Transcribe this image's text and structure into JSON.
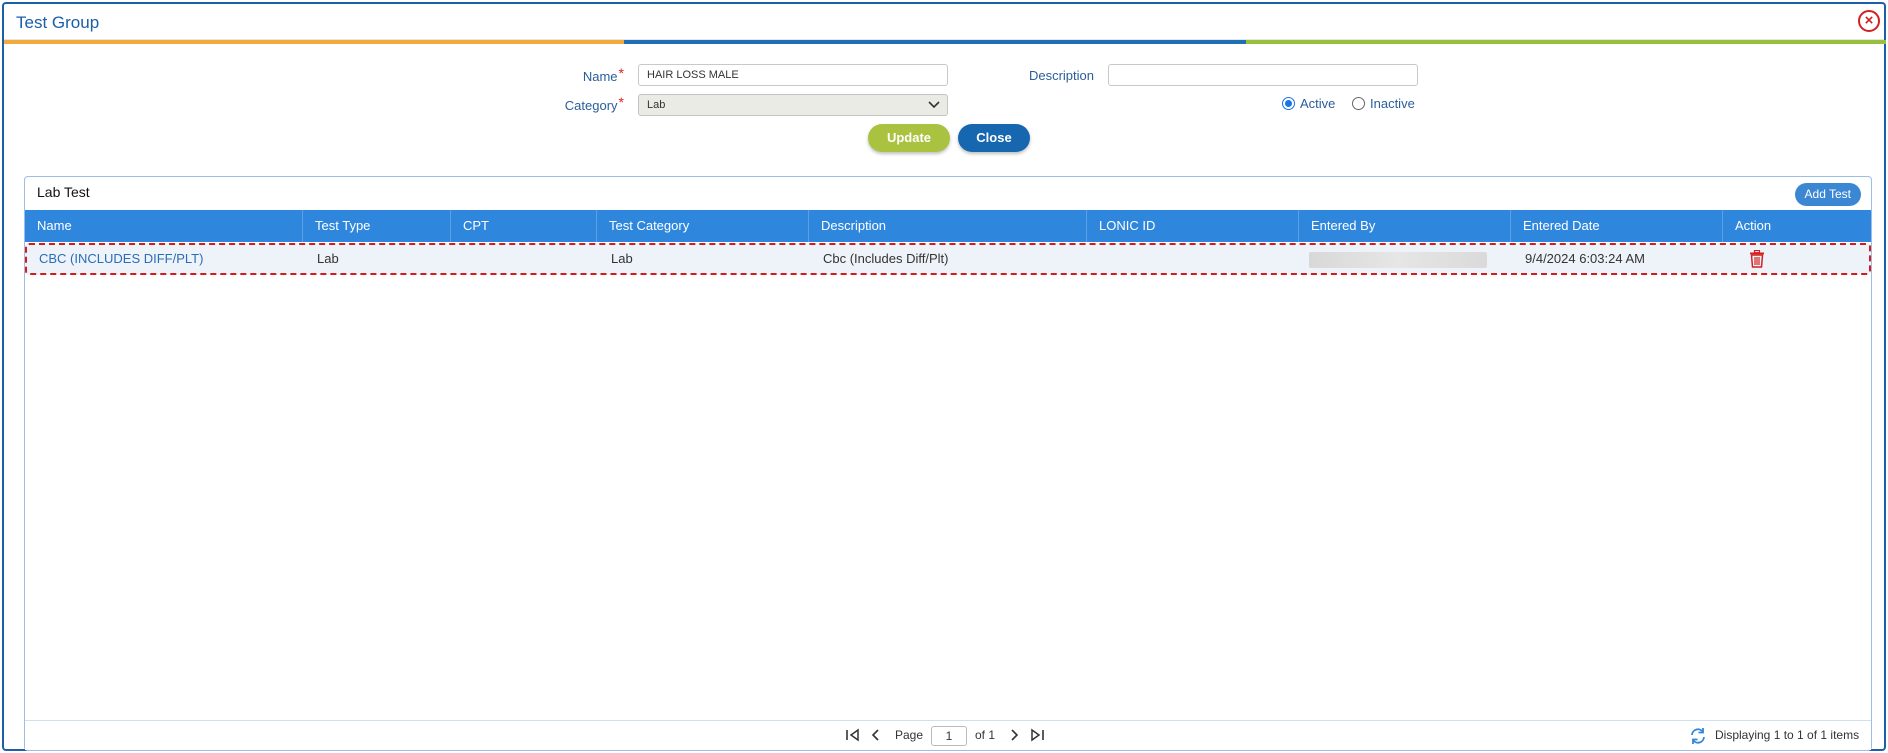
{
  "dialog": {
    "title": "Test Group"
  },
  "form": {
    "name_label": "Name",
    "name_value": "HAIR LOSS  MALE",
    "category_label": "Category",
    "category_value": "Lab",
    "description_label": "Description",
    "description_value": "",
    "required_marker": "*",
    "status_options": [
      {
        "label": "Active",
        "selected": true
      },
      {
        "label": "Inactive",
        "selected": false
      }
    ],
    "update_label": "Update",
    "close_label": "Close"
  },
  "lab_test": {
    "title": "Lab Test",
    "add_test_label": "Add Test",
    "columns": [
      "Name",
      "Test Type",
      "CPT",
      "Test Category",
      "Description",
      "LONIC ID",
      "Entered By",
      "Entered Date",
      "Action"
    ],
    "rows": [
      {
        "name": "CBC (INCLUDES DIFF/PLT)",
        "test_type": "Lab",
        "cpt": "",
        "test_category": "Lab",
        "description": "Cbc (Includes Diff/Plt)",
        "lonic_id": "",
        "entered_by": "",
        "entered_date": "9/4/2024 6:03:24 AM"
      }
    ]
  },
  "pager": {
    "page_label": "Page",
    "page_value": "1",
    "of_label": "of 1",
    "summary": "Displaying 1 to 1 of 1 items"
  },
  "colors": {
    "accent_blue": "#2f87dd",
    "update_green": "#a9c23f",
    "close_blue": "#1767b0",
    "danger_red": "#d41c1c"
  },
  "icons": [
    "close-circle-icon",
    "chevron-down-icon",
    "trash-icon",
    "first-page-icon",
    "prev-page-icon",
    "next-page-icon",
    "last-page-icon",
    "refresh-icon"
  ]
}
